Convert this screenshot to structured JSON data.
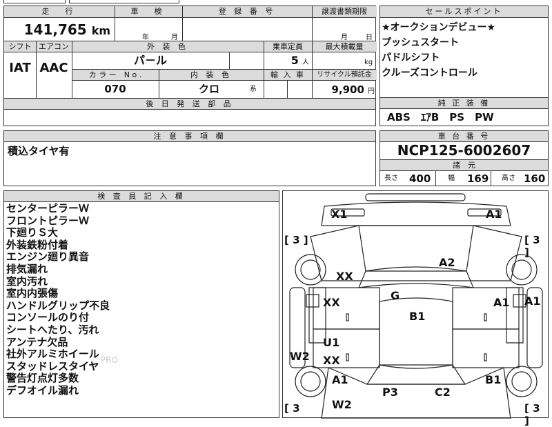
{
  "header": {
    "mileage_label": "走　行",
    "inspection_label": "車　検",
    "registration_label": "登 録 番 号",
    "transfer_label": "譲渡書類期限",
    "sales_point_label": "セールスポイント",
    "mileage_value": "141,765",
    "mileage_unit": "km",
    "year_unit": "年",
    "month_unit": "月",
    "transfer_month": "月",
    "transfer_day": "日"
  },
  "specs": {
    "shift_label": "シフト",
    "aircon_label": "エアコン",
    "exterior_color_label": "外 装 色",
    "capacity_label": "乗車定員",
    "max_load_label": "最大積載量",
    "shift_value": "IAT",
    "aircon_value": "AAC",
    "exterior_color_value": "パ－ル",
    "capacity_value": "5",
    "capacity_unit": "人",
    "max_load_unit": "kg",
    "color_no_label": "カ ラ ー　N o .",
    "interior_color_label": "内 装 色",
    "import_label": "輸 入 車",
    "recycle_label": "リサイクル預託金",
    "color_no_value": "070",
    "interior_color_value": "クロ",
    "interior_color_suffix": "系",
    "recycle_value": "9,900",
    "recycle_unit": "円",
    "later_parts_label": "後 日 発 送 部 品"
  },
  "sales_points": [
    "★オークションデビュー★",
    "プッシュスタート",
    "パドルシフト",
    "クルーズコントロール"
  ],
  "genuine_equipment": {
    "label": "純 正 装 備",
    "value": "ABS　ｴｱB　PS　PW"
  },
  "notes": {
    "label": "注 意 事 項 欄",
    "value": "積込タイヤ有"
  },
  "chassis": {
    "label": "車 台 番 号",
    "value": "NCP125-6002607",
    "dimensions_label": "諸　元",
    "length_label": "長さ",
    "length_value": "400",
    "width_label": "幅",
    "width_value": "169",
    "height_label": "高さ",
    "height_value": "160"
  },
  "inspector": {
    "label": "検 査 員 記 入 欄",
    "items": [
      "センターピラーＷ",
      "フロントピラーＷ",
      "下廻りＳ大",
      "外装鉄粉付着",
      "エンジン廻り異音",
      "排気漏れ",
      "室内汚れ",
      "室内内張傷",
      "ハンドルグリップ不良",
      "コンソールのり付",
      "シートへたり、汚れ",
      "アンテナ欠品",
      "社外アルミホイール",
      "スタッドレスタイヤ",
      "警告灯点灯多数",
      "デフオイル漏れ"
    ],
    "watermark": "PRO"
  },
  "diagram": {
    "marks": {
      "x1": "X1",
      "a1_top": "A1",
      "a2": "A2",
      "xx_upper": "XX",
      "g": "G",
      "xx_left": "XX",
      "b1_center": "B1",
      "a1_right_door": "A1",
      "a1_far_right": "A1",
      "u1": "U1",
      "xx_lower": "XX",
      "w2_left": "W2",
      "a1_lower_left": "A1",
      "b1_lower_right": "B1",
      "p3": "P3",
      "c2": "C2",
      "w2_bottom": "W2"
    },
    "tire_tl": "[ 3 ]",
    "tire_tr": "[ 3 ]",
    "tire_bl": "[ 3",
    "tire_br": "[ 3 ]"
  }
}
